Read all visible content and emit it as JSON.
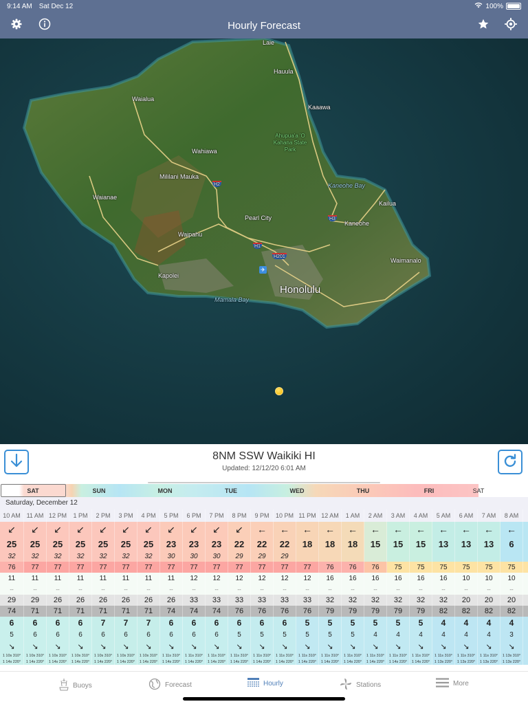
{
  "status_bar": {
    "time": "9:14 AM",
    "date": "Sat Dec 12",
    "battery": "100%"
  },
  "nav": {
    "title": "Hourly Forecast"
  },
  "map": {
    "labels": {
      "laie": "Laie",
      "hauula": "Hauula",
      "kaaawa": "Kaaawa",
      "waialua": "Waialua",
      "wahiawa": "Wahiawa",
      "park": "Ahupua'a 'O Kahana State Park",
      "mililani": "Mililani Mauka",
      "waianae": "Waianae",
      "pearl_city": "Pearl City",
      "kaneohe_bay": "Kaneohe Bay",
      "kailua": "Kailua",
      "kaneohe": "Kaneohe",
      "waipahu": "Waipahu",
      "waimanalo": "Waimanalo",
      "kapolei": "Kapolei",
      "mamala_bay": "Mamala Bay",
      "honolulu": "Honolulu"
    },
    "shields": {
      "h1": "H1",
      "h2": "H2",
      "h3": "H3",
      "h201": "H201"
    }
  },
  "panel": {
    "location": "8NM SSW Waikiki HI",
    "updated": "Updated: 12/12/20 6:01 AM",
    "date_header": "Saturday, December 12"
  },
  "days": [
    "SAT",
    "SUN",
    "MON",
    "TUE",
    "WED",
    "THU",
    "FRI",
    "SAT"
  ],
  "hours": [
    "10 AM",
    "11 AM",
    "12 PM",
    "1 PM",
    "2 PM",
    "3 PM",
    "4 PM",
    "5 PM",
    "6 PM",
    "7 PM",
    "8 PM",
    "9 PM",
    "10 PM",
    "11 PM",
    "12 AM",
    "1 AM",
    "2 AM",
    "3 AM",
    "4 AM",
    "5 AM",
    "6 AM",
    "7 AM",
    "8 AM"
  ],
  "rows": {
    "wind_dir": [
      "↙",
      "↙",
      "↙",
      "↙",
      "↙",
      "↙",
      "↙",
      "↙",
      "↙",
      "↙",
      "↙",
      "←",
      "←",
      "←",
      "←",
      "←",
      "←",
      "←",
      "←",
      "←",
      "←",
      "←",
      "←"
    ],
    "wind_speed": [
      "25",
      "25",
      "25",
      "25",
      "25",
      "25",
      "25",
      "23",
      "23",
      "23",
      "22",
      "22",
      "22",
      "18",
      "18",
      "18",
      "15",
      "15",
      "15",
      "13",
      "13",
      "13",
      "6"
    ],
    "wind_gust": [
      "32",
      "32",
      "32",
      "32",
      "32",
      "32",
      "32",
      "30",
      "30",
      "30",
      "29",
      "29",
      "29",
      "",
      "",
      "",
      "",
      "",
      "",
      "",
      "",
      "",
      ""
    ],
    "air_temp": [
      "76",
      "77",
      "77",
      "77",
      "77",
      "77",
      "77",
      "77",
      "77",
      "77",
      "77",
      "77",
      "77",
      "77",
      "76",
      "76",
      "76",
      "75",
      "75",
      "75",
      "75",
      "75",
      "75"
    ],
    "visibility": [
      "11",
      "11",
      "11",
      "11",
      "11",
      "11",
      "11",
      "11",
      "12",
      "12",
      "12",
      "12",
      "12",
      "12",
      "16",
      "16",
      "16",
      "16",
      "16",
      "16",
      "10",
      "10",
      "10"
    ],
    "precip": [
      "--",
      "--",
      "--",
      "--",
      "--",
      "--",
      "--",
      "--",
      "--",
      "--",
      "--",
      "--",
      "--",
      "--",
      "--",
      "--",
      "--",
      "--",
      "--",
      "--",
      "--",
      "--",
      "--"
    ],
    "cloud": [
      "29",
      "29",
      "26",
      "26",
      "26",
      "26",
      "26",
      "26",
      "33",
      "33",
      "33",
      "33",
      "33",
      "33",
      "32",
      "32",
      "32",
      "32",
      "32",
      "32",
      "20",
      "20",
      "20"
    ],
    "humidity": [
      "74",
      "71",
      "71",
      "71",
      "71",
      "71",
      "71",
      "74",
      "74",
      "74",
      "76",
      "76",
      "76",
      "76",
      "79",
      "79",
      "79",
      "79",
      "79",
      "82",
      "82",
      "82",
      "82"
    ],
    "wave_height": [
      "6",
      "6",
      "6",
      "6",
      "7",
      "7",
      "7",
      "6",
      "6",
      "6",
      "6",
      "6",
      "6",
      "5",
      "5",
      "5",
      "5",
      "5",
      "5",
      "4",
      "4",
      "4",
      "4"
    ],
    "wave_period": [
      "5",
      "6",
      "6",
      "6",
      "6",
      "6",
      "6",
      "6",
      "6",
      "6",
      "5",
      "5",
      "5",
      "5",
      "5",
      "5",
      "4",
      "4",
      "4",
      "4",
      "4",
      "4",
      "3"
    ],
    "wave_dir": [
      "↘",
      "↘",
      "↘",
      "↘",
      "↘",
      "↘",
      "↘",
      "↘",
      "↘",
      "↘",
      "↘",
      "↘",
      "↘",
      "↘",
      "↘",
      "↘",
      "↘",
      "↘",
      "↘",
      "↘",
      "↘",
      "↘",
      "↘"
    ],
    "swell1": [
      "1 10s 310°",
      "1 10s 310°",
      "1 10s 310°",
      "1 10s 310°",
      "1 10s 310°",
      "1 10s 310°",
      "1 10s 310°",
      "1 11s 310°",
      "1 11s 310°",
      "1 11s 310°",
      "1 11s 310°",
      "1 11s 310°",
      "1 11s 310°",
      "1 11s 310°",
      "1 11s 310°",
      "1 11s 310°",
      "1 11s 310°",
      "1 11s 310°",
      "1 11s 310°",
      "1 11s 310°",
      "1 11s 310°",
      "1 11s 310°",
      "1 13s 310°"
    ],
    "swell2": [
      "1 14s 220°",
      "1 14s 220°",
      "1 14s 220°",
      "1 14s 220°",
      "1 14s 220°",
      "1 14s 220°",
      "1 14s 220°",
      "1 14s 220°",
      "1 14s 220°",
      "1 14s 220°",
      "1 14s 220°",
      "1 14s 220°",
      "1 14s 220°",
      "1 14s 220°",
      "1 14s 220°",
      "1 14s 220°",
      "1 14s 220°",
      "1 14s 220°",
      "1 14s 220°",
      "1 13s 220°",
      "1 13s 220°",
      "1 13s 220°",
      "1 13s 220°"
    ]
  },
  "row_colors": {
    "wind": [
      "#fcc7bc",
      "#fcc7bc",
      "#fcc7bc",
      "#fcc7bc",
      "#fcc7bc",
      "#fcc7bc",
      "#fcc7bc",
      "#fccab9",
      "#fccab9",
      "#fccab9",
      "#fbcfb8",
      "#fbcfb8",
      "#f9d2b7",
      "#f8d5b6",
      "#f7d8b7",
      "#f4dbb8",
      "#d9ecd7",
      "#c9efe0",
      "#c9efe0",
      "#c3ede6",
      "#c3ede6",
      "#c3ede6",
      "#b9e6f3"
    ],
    "temp": [
      "#fcb2ac",
      "#fca6a2",
      "#fca6a2",
      "#fca6a2",
      "#fca6a2",
      "#fca6a2",
      "#fca6a2",
      "#fca6a2",
      "#fca6a2",
      "#fca6a2",
      "#fca6a2",
      "#fca6a2",
      "#fca6a2",
      "#fca6a2",
      "#fcb2ac",
      "#fcb2ac",
      "#fcc4a6",
      "#fde3a4",
      "#fde3a4",
      "#fde3a4",
      "#fde3a4",
      "#fde3a4",
      "#fde3a4"
    ],
    "wave": [
      "#c9f0ec",
      "#c9f0ec",
      "#c9f0ec",
      "#c9f0ec",
      "#c6eeea",
      "#c6eeea",
      "#c6eeea",
      "#c6eeee",
      "#c6eeee",
      "#c6eeee",
      "#c4ecef",
      "#c4ecef",
      "#c4ecef",
      "#c1e9f2",
      "#c1e9f2",
      "#c1e9f2",
      "#c1e9f2",
      "#c1e9f2",
      "#c1e9f2",
      "#bde6f3",
      "#bde6f3",
      "#bde6f3",
      "#bde6f3"
    ]
  },
  "tabs": [
    {
      "label": "Buoys",
      "icon": "buoy-icon"
    },
    {
      "label": "Forecast",
      "icon": "globe-icon"
    },
    {
      "label": "Hourly",
      "icon": "hourly-table-icon",
      "active": true
    },
    {
      "label": "Stations",
      "icon": "windmill-icon"
    },
    {
      "label": "More",
      "icon": "menu-icon"
    }
  ],
  "colors": {
    "nav_bar": "#5e7092",
    "accent": "#3a8fd6",
    "active_tab": "#4f7fb8"
  }
}
